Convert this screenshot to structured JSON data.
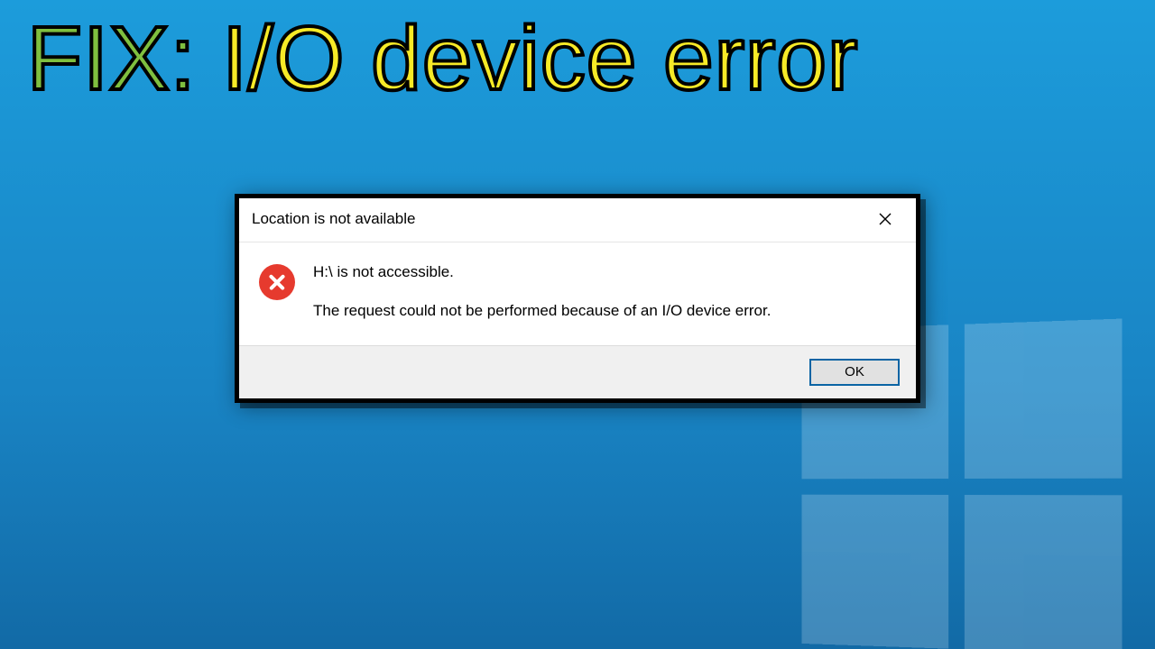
{
  "headline": {
    "prefix": "FIX:",
    "rest": " I/O device error"
  },
  "dialog": {
    "title": "Location is not available",
    "close_icon": "close",
    "message_line1": "H:\\ is not accessible.",
    "message_line2": "The request could not be performed because of an I/O device error.",
    "ok_label": "OK"
  }
}
